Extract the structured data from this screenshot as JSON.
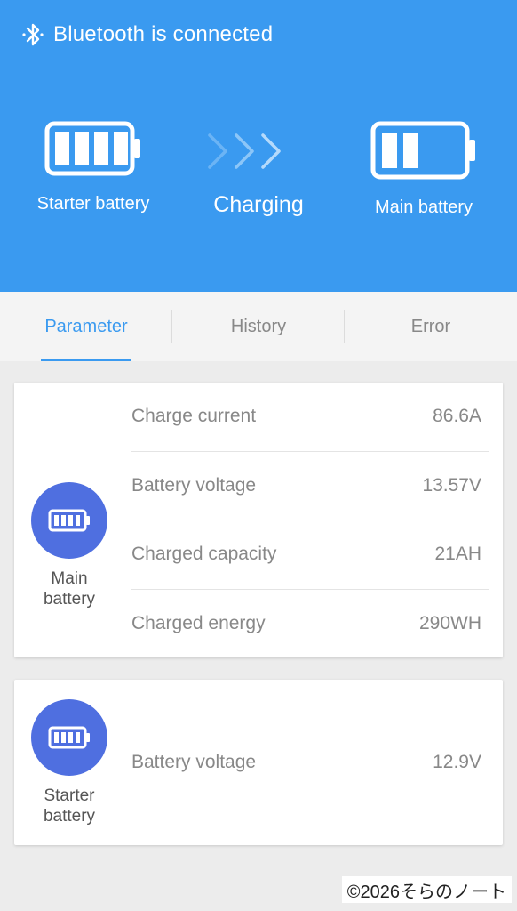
{
  "status": {
    "bluetooth_text": "Bluetooth is connected"
  },
  "flow": {
    "source_label": "Starter battery",
    "source_level": 1.0,
    "state_label": "Charging",
    "target_label": "Main battery",
    "target_level": 0.5
  },
  "tabs": [
    {
      "label": "Parameter",
      "active": true
    },
    {
      "label": "History",
      "active": false
    },
    {
      "label": "Error",
      "active": false
    }
  ],
  "main_card": {
    "title": "Main battery",
    "rows": [
      {
        "label": "Charge current",
        "value": "86.6A"
      },
      {
        "label": "Battery voltage",
        "value": "13.57V"
      },
      {
        "label": "Charged capacity",
        "value": "21AH"
      },
      {
        "label": "Charged energy",
        "value": "290WH"
      }
    ]
  },
  "starter_card": {
    "title": "Starter battery",
    "rows": [
      {
        "label": "Battery voltage",
        "value": "12.9V"
      }
    ]
  },
  "watermark": "©2026そらのノート",
  "colors": {
    "header_bg": "#3a9af0",
    "accent": "#3a9af0",
    "icon_circle": "#4f6fe0"
  }
}
